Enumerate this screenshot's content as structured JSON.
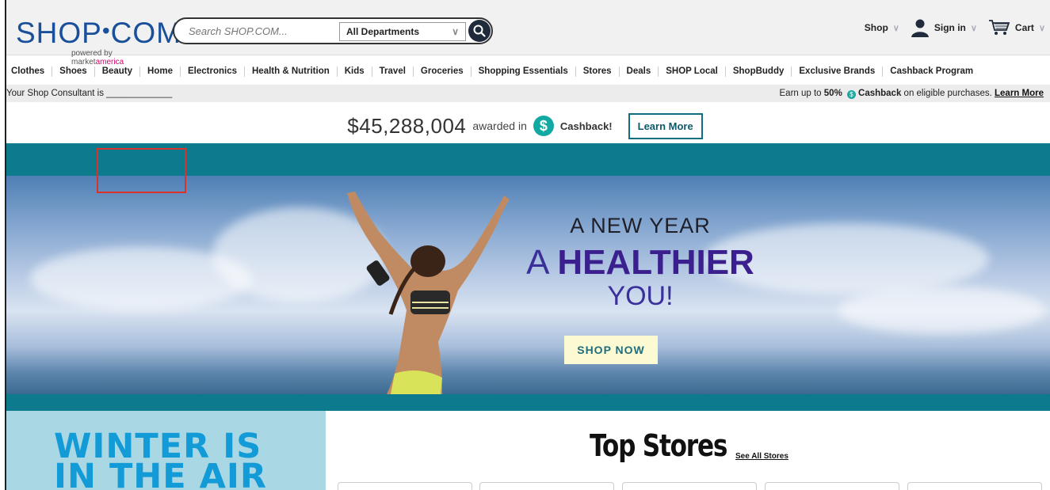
{
  "header": {
    "logo_main": "SHOP",
    "logo_dot": "•",
    "logo_com": "COM",
    "logo_reg": "®",
    "logo_sub_prefix": "powered by market",
    "logo_sub_brand": "america",
    "search_placeholder": "Search SHOP.COM...",
    "department": "All Departments",
    "shop_label": "Shop",
    "signin_label": "Sign in",
    "cart_label": "Cart"
  },
  "nav": {
    "items": [
      "Clothes",
      "Shoes",
      "Beauty",
      "Home",
      "Electronics",
      "Health & Nutrition",
      "Kids",
      "Travel",
      "Groceries",
      "Shopping Essentials",
      "Stores",
      "Deals",
      "SHOP Local",
      "ShopBuddy",
      "Exclusive Brands",
      "Cashback Program"
    ]
  },
  "consultant_bar": {
    "left": "Your Shop Consultant is _____________",
    "right_prefix": "Earn up to ",
    "right_percent": "50%",
    "right_cashback": "Cashback",
    "right_suffix": " on eligible purchases.",
    "learn_more": "Learn More"
  },
  "award": {
    "amount": "$45,288,004",
    "text": "awarded in",
    "cashback": "Cashback!",
    "learn_more": "Learn More"
  },
  "hero": {
    "line1": "A NEW YEAR",
    "line2_a": "A ",
    "line2_b": "HEALTHIER",
    "line3": "YOU!",
    "cta": "SHOP NOW"
  },
  "winter": {
    "line1": "WINTER IS",
    "line2": "IN THE AIR"
  },
  "top_stores": {
    "title": "Top Stores",
    "see_all": "See All Stores"
  },
  "colors": {
    "teal": "#0d7a8e",
    "logo_blue": "#1a4f9a",
    "cashback_teal": "#13a9a3",
    "hero_purple": "#3b1f8e",
    "marker_red": "#d9322a"
  }
}
